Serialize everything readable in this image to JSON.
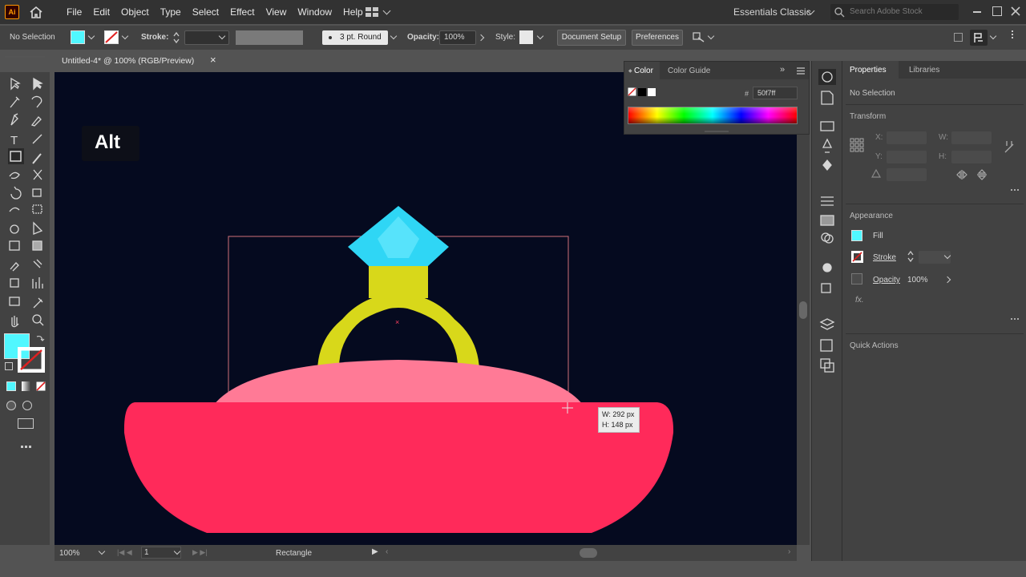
{
  "app": {
    "logo": "Ai",
    "menu": [
      "File",
      "Edit",
      "Object",
      "Type",
      "Select",
      "Effect",
      "View",
      "Window",
      "Help"
    ],
    "workspace": "Essentials Classic",
    "search_placeholder": "Search Adobe Stock"
  },
  "control_bar": {
    "selection": "No Selection",
    "stroke_label": "Stroke:",
    "brush": "3 pt. Round",
    "opacity_label": "Opacity:",
    "opacity_value": "100%",
    "style_label": "Style:",
    "document_setup": "Document Setup",
    "preferences": "Preferences"
  },
  "document": {
    "tab_title": "Untitled-4* @ 100% (RGB/Preview)",
    "close_glyph": "×"
  },
  "canvas": {
    "key_hint": "Alt",
    "measure_w": "W: 292 px",
    "measure_h": "H: 148 px",
    "colors": {
      "background": "#050a1f",
      "gem": "#2fd6f5",
      "gem_light": "#57e3fb",
      "ring": "#d8d81a",
      "cushion_top": "#ff7a96",
      "cushion_base": "#ff2a5a"
    }
  },
  "status_bar": {
    "zoom": "100%",
    "artboard": "1",
    "tool": "Rectangle"
  },
  "color_panel": {
    "tabs": [
      "Color",
      "Color Guide"
    ],
    "hex_label": "#",
    "hex": "50f7ff"
  },
  "properties": {
    "tabs": [
      "Properties",
      "Libraries"
    ],
    "selection": "No Selection",
    "transform": "Transform",
    "x_label": "X:",
    "y_label": "Y:",
    "w_label": "W:",
    "h_label": "H:",
    "appearance": "Appearance",
    "fill": "Fill",
    "stroke": "Stroke",
    "opacity": "Opacity",
    "opacity_value": "100%",
    "fx": "fx.",
    "quick_actions": "Quick Actions",
    "fill_color": "#50f7ff"
  }
}
